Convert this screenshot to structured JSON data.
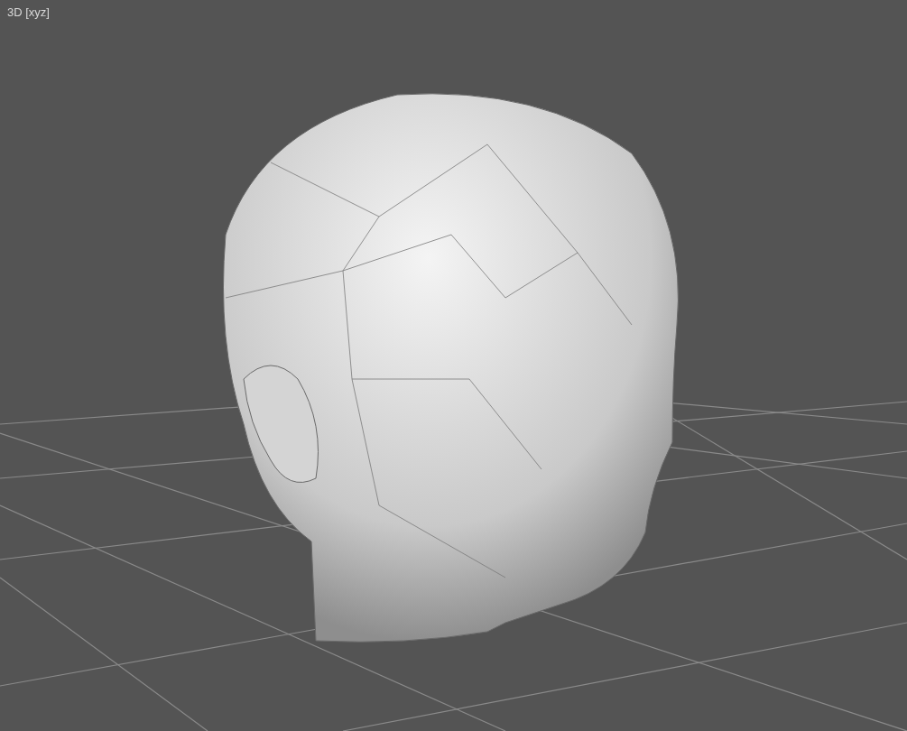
{
  "viewport": {
    "label": "3D [xyz]"
  }
}
